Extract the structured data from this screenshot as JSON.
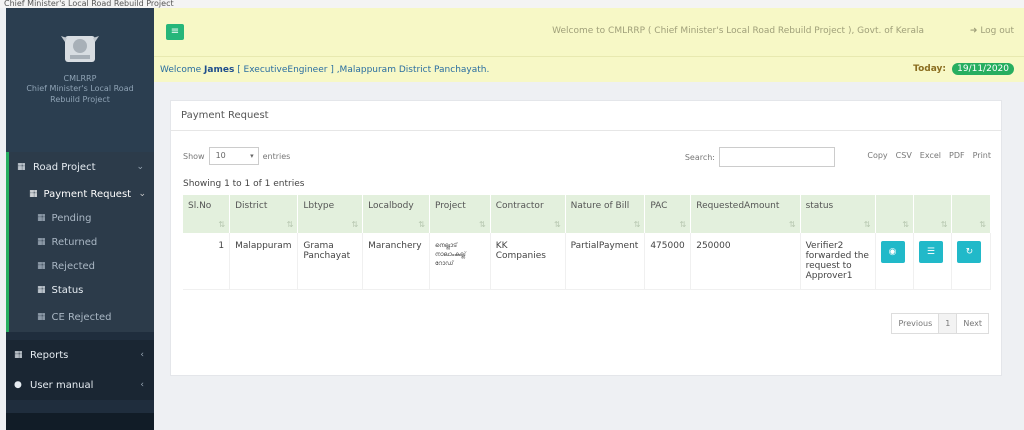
{
  "browser": {
    "tab_text": "Chief Minister's Local Road Rebuild Project"
  },
  "sidebar": {
    "brand_short": "CMLRRP",
    "brand_full": "Chief Minister's Local Road Rebuild Project",
    "road_project": "Road Project",
    "payment_request": "Payment Request",
    "sub_items": [
      "Pending",
      "Returned",
      "Rejected",
      "Status",
      "CE Rejected"
    ],
    "reports": "Reports",
    "user_manual": "User manual"
  },
  "header": {
    "welcome": "Welcome to CMLRRP ( Chief Minister's Local Road Rebuild Project ), Govt. of Kerala",
    "logout": "Log out",
    "welcome_prefix": "Welcome",
    "user_name": "James",
    "user_role_office": "[ ExecutiveEngineer ] ,Malappuram District Panchayath.",
    "today_label": "Today:",
    "today_date": "19/11/2020"
  },
  "panel": {
    "title": "Payment Request",
    "show_label": "Show",
    "entries_value": "10",
    "entries_label": "entries",
    "search_label": "Search:",
    "search_value": "",
    "export_buttons": [
      "Copy",
      "CSV",
      "Excel",
      "PDF",
      "Print"
    ],
    "showing_text": "Showing 1 to 1 of 1 entries",
    "columns": [
      "Sl.No",
      "District",
      "Lbtype",
      "Localbody",
      "Project",
      "Contractor",
      "Nature of Bill",
      "PAC",
      "RequestedAmount",
      "status",
      "",
      "",
      ""
    ],
    "rows": [
      {
        "slno": "1",
        "district": "Malappuram",
        "lbtype": "Grama Panchayat",
        "localbody": "Maranchery",
        "project": "നെല്ലാട് നാലാംകല്ല് റോഡ്",
        "contractor": "KK Companies",
        "nature": "PartialPayment",
        "pac": "475000",
        "amount": "250000",
        "status": "Verifier2 forwarded the request to Approver1"
      }
    ],
    "pager": {
      "prev": "Previous",
      "page": "1",
      "next": "Next"
    }
  },
  "colors": {
    "accent_green": "#26b67a",
    "action_cyan": "#21b9c9",
    "header_bg": "#f7f8c6",
    "sidebar_bg": "#1f2d3d"
  },
  "icons": [
    "menu-toggle-icon",
    "view-icon",
    "list-icon",
    "history-icon",
    "logout-icon",
    "user-icon",
    "grid-icon"
  ]
}
